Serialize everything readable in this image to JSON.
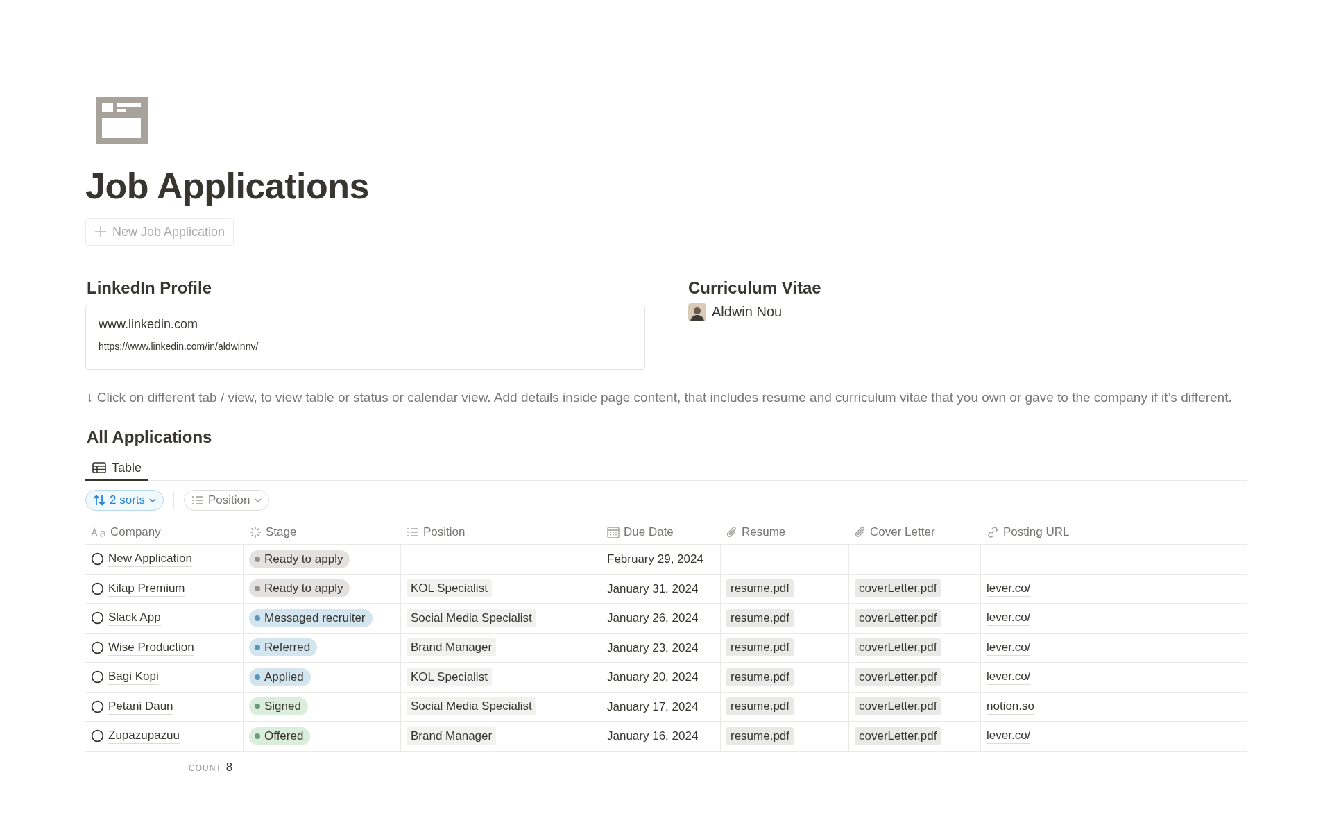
{
  "page": {
    "title": "Job Applications",
    "new_button": "New Job Application"
  },
  "linkedin": {
    "heading": "LinkedIn Profile",
    "bookmark_title": "www.linkedin.com",
    "bookmark_url": "https://www.linkedin.com/in/aldwinnv/"
  },
  "cv": {
    "heading": "Curriculum Vitae",
    "person": "Aldwin Nou"
  },
  "note": "↓ Click on different tab / view, to view table or status or calendar view. Add details inside page content, that includes resume and curriculum vitae that you own or gave to the company if it’s different.",
  "database": {
    "title": "All Applications",
    "tabs": [
      {
        "label": "Table",
        "selected": true
      }
    ],
    "filters": [
      {
        "kind": "sort",
        "label": "2 sorts"
      },
      {
        "kind": "group",
        "label": "Position"
      }
    ],
    "columns": [
      {
        "kind": "title",
        "label": "Company"
      },
      {
        "kind": "status",
        "label": "Stage"
      },
      {
        "kind": "list",
        "label": "Position"
      },
      {
        "kind": "date",
        "label": "Due Date"
      },
      {
        "kind": "file",
        "label": "Resume"
      },
      {
        "kind": "file",
        "label": "Cover Letter"
      },
      {
        "kind": "url",
        "label": "Posting URL"
      }
    ],
    "rows": [
      {
        "company": "New Application",
        "stage": {
          "label": "Ready to apply",
          "color": "#91918e"
        },
        "due_date": "February 29, 2024"
      },
      {
        "company": "Kilap Premium",
        "stage": {
          "label": "Ready to apply",
          "color": "#91918e"
        },
        "position": "KOL Specialist",
        "due_date": "January 31, 2024",
        "resume": "resume.pdf",
        "cover_letter": "coverLetter.pdf",
        "url": "lever.co/"
      },
      {
        "company": "Slack App",
        "stage": {
          "label": "Messaged recruiter",
          "color": "#5b97bd"
        },
        "position": "Social Media Specialist",
        "due_date": "January 26, 2024",
        "resume": "resume.pdf",
        "cover_letter": "coverLetter.pdf",
        "url": "lever.co/"
      },
      {
        "company": "Wise Production",
        "stage": {
          "label": "Referred",
          "color": "#5b97bd"
        },
        "position": "Brand Manager",
        "due_date": "January 23, 2024",
        "resume": "resume.pdf",
        "cover_letter": "coverLetter.pdf",
        "url": "lever.co/"
      },
      {
        "company": "Bagi Kopi",
        "stage": {
          "label": "Applied",
          "color": "#5b97bd"
        },
        "position": "KOL Specialist",
        "due_date": "January 20, 2024",
        "resume": "resume.pdf",
        "cover_letter": "coverLetter.pdf",
        "url": "lever.co/"
      },
      {
        "company": "Petani Daun",
        "stage": {
          "label": "Signed",
          "color": "#6c9b7d"
        },
        "position": "Social Media Specialist",
        "due_date": "January 17, 2024",
        "resume": "resume.pdf",
        "cover_letter": "coverLetter.pdf",
        "url": "notion.so"
      },
      {
        "company": "Zupazupazuu",
        "stage": {
          "label": "Offered",
          "color": "#6c9b7d"
        },
        "position": "Brand Manager",
        "due_date": "January 16, 2024",
        "resume": "resume.pdf",
        "cover_letter": "coverLetter.pdf",
        "url": "lever.co/"
      }
    ],
    "count_label": "COUNT",
    "count": "8"
  }
}
